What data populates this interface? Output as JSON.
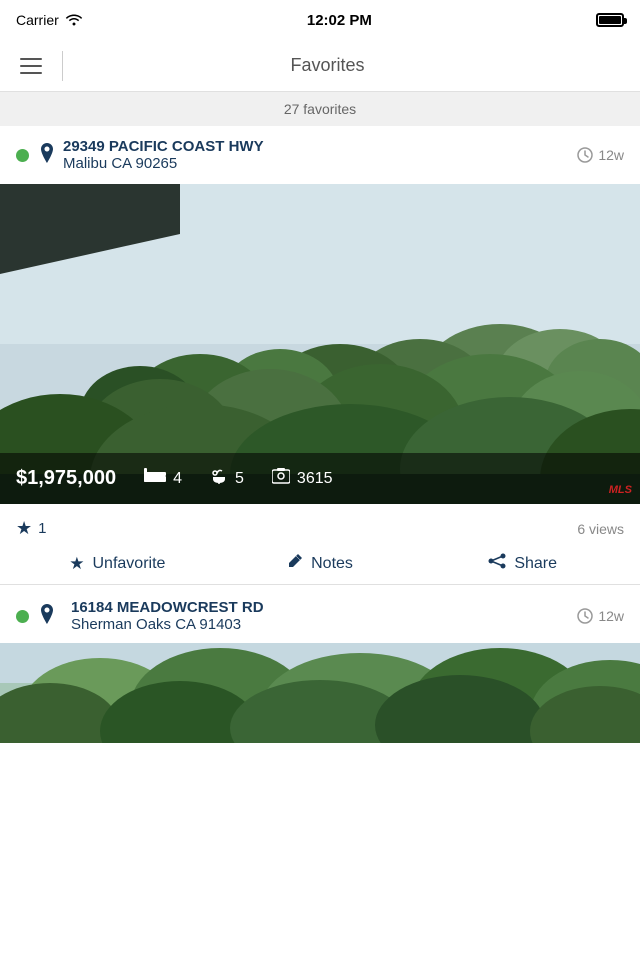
{
  "statusBar": {
    "carrier": "Carrier",
    "time": "12:02 PM"
  },
  "navBar": {
    "title": "Favorites",
    "menuIcon": "≡"
  },
  "countBar": {
    "text": "27 favorites"
  },
  "listings": [
    {
      "id": "listing-1",
      "statusColor": "#4caf50",
      "street": "29349 PACIFIC COAST HWY",
      "city": "Malibu CA 90265",
      "timeAgo": "12w",
      "price": "$1,975,000",
      "beds": "4",
      "baths": "5",
      "sqft": "3615",
      "starCount": "1",
      "views": "6 views",
      "unfavoriteLabel": "Unfavorite",
      "notesLabel": "Notes",
      "shareLabel": "Share"
    },
    {
      "id": "listing-2",
      "statusColor": "#4caf50",
      "street": "16184 MEADOWCREST RD",
      "city": "Sherman Oaks CA 91403",
      "timeAgo": "12w"
    }
  ],
  "icons": {
    "pin": "📍",
    "clock": "⏱",
    "bed": "🛏",
    "bath": "🚿",
    "photo": "📷",
    "star": "★",
    "pencil": "✏",
    "share": "⋈"
  }
}
